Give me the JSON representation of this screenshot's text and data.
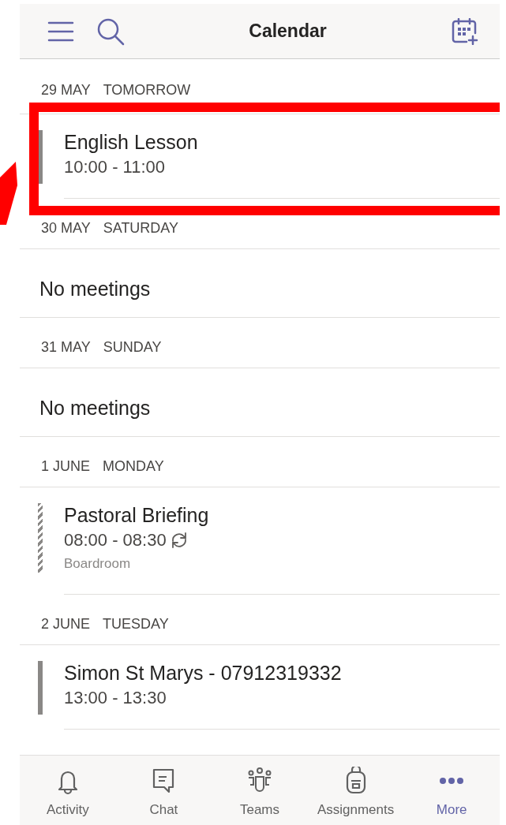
{
  "header": {
    "title": "Calendar"
  },
  "days": [
    {
      "date": "29 MAY",
      "day": "TOMORROW",
      "events": [
        {
          "title": "English Lesson",
          "time": "10:00 - 11:00",
          "kind": "busy",
          "recurring": false,
          "highlighted": true
        }
      ]
    },
    {
      "date": "30 MAY",
      "day": "SATURDAY",
      "empty_text": "No meetings"
    },
    {
      "date": "31 MAY",
      "day": "SUNDAY",
      "empty_text": "No meetings"
    },
    {
      "date": "1 JUNE",
      "day": "MONDAY",
      "events": [
        {
          "title": "Pastoral Briefing",
          "time": "08:00 - 08:30",
          "location": "Boardroom",
          "kind": "tentative",
          "recurring": true,
          "highlighted": false
        }
      ]
    },
    {
      "date": "2 JUNE",
      "day": "TUESDAY",
      "events": [
        {
          "title": "Simon St Marys - 07912319332",
          "time": "13:00 - 13:30",
          "kind": "busy",
          "recurring": false,
          "highlighted": false
        }
      ]
    }
  ],
  "nav": [
    {
      "label": "Activity",
      "kind": "bell",
      "selected": false
    },
    {
      "label": "Chat",
      "kind": "chat",
      "selected": false
    },
    {
      "label": "Teams",
      "kind": "people",
      "selected": false
    },
    {
      "label": "Assignments",
      "kind": "backpack",
      "selected": false
    },
    {
      "label": "More",
      "kind": "dots",
      "selected": true
    }
  ]
}
